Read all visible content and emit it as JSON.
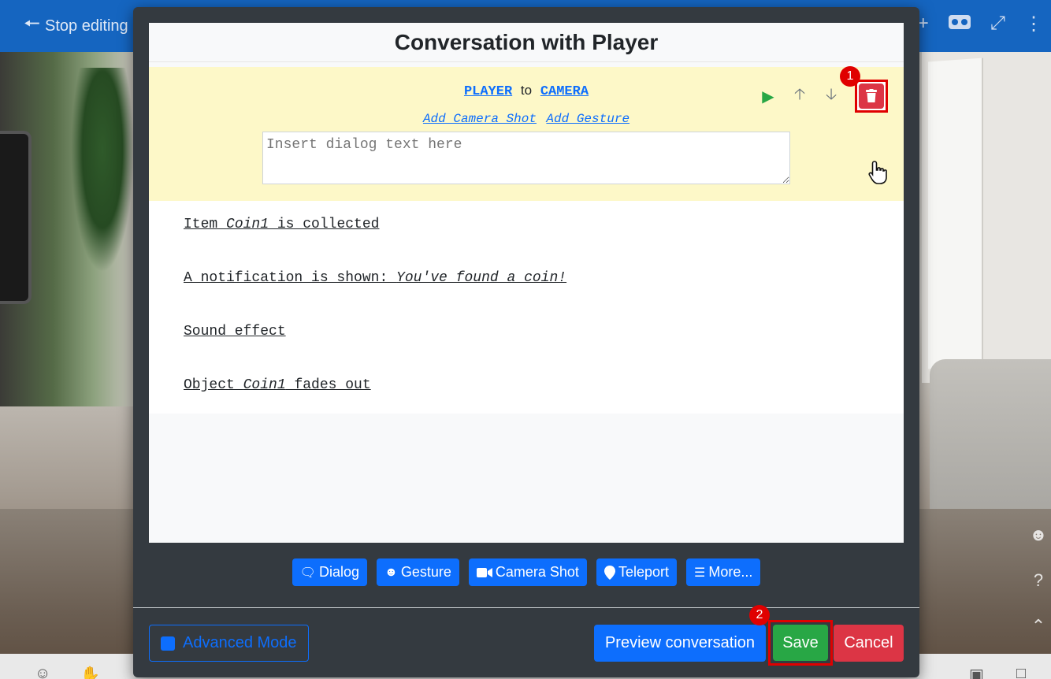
{
  "topbar": {
    "stop_editing_label": "Stop editing",
    "icons": [
      "arrow-left-icon",
      "plus-icon",
      "vr-headset-icon",
      "expand-icon",
      "more-vertical-icon"
    ]
  },
  "modal": {
    "title": "Conversation with Player",
    "dialog": {
      "speaker_from": "PLAYER",
      "to_label": "to",
      "speaker_to": "CAMERA",
      "add_camera_shot": "Add Camera Shot",
      "add_gesture": "Add Gesture",
      "textarea_placeholder": "Insert dialog text here"
    },
    "actions": [
      {
        "prefix": "Item ",
        "italic": "Coin1",
        "suffix": " is collected"
      },
      {
        "prefix": "A notification is shown: ",
        "italic": "You've found a coin!",
        "suffix": ""
      },
      {
        "prefix": "Sound effect",
        "italic": "",
        "suffix": ""
      },
      {
        "prefix": "Object ",
        "italic": "Coin1",
        "suffix": " fades out"
      }
    ],
    "add_buttons": {
      "dialog": "Dialog",
      "gesture": "Gesture",
      "camera_shot": "Camera Shot",
      "teleport": "Teleport",
      "more": "More..."
    },
    "footer": {
      "advanced_mode": "Advanced Mode",
      "preview": "Preview conversation",
      "save": "Save",
      "cancel": "Cancel"
    }
  },
  "annotations": {
    "step1": "1",
    "step2": "2"
  },
  "colors": {
    "primary": "#0d6efd",
    "success": "#28a745",
    "danger": "#dc3545",
    "highlight": "#e00000",
    "dialog_bg": "#fdf8c8",
    "modal_bg": "#343a40",
    "topbar": "#1565c0"
  }
}
